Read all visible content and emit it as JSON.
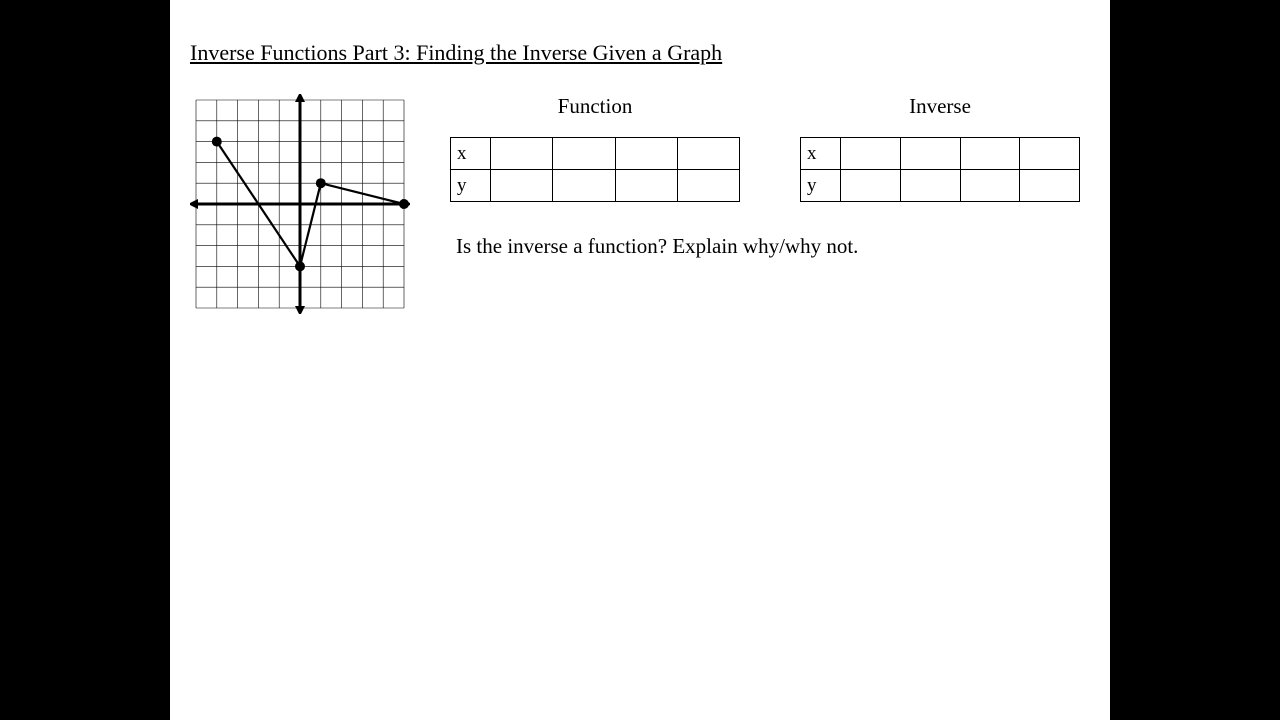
{
  "title": "Inverse Functions Part 3: Finding the Inverse Given a Graph",
  "tables": {
    "function": {
      "title": "Function",
      "row_x_label": "x",
      "row_y_label": "y"
    },
    "inverse": {
      "title": "Inverse",
      "row_x_label": "x",
      "row_y_label": "y"
    }
  },
  "question": "Is the inverse a function? Explain why/why not.",
  "chart_data": {
    "type": "line",
    "title": "",
    "x_range": [
      -5,
      5
    ],
    "y_range": [
      -5,
      5
    ],
    "grid": true,
    "points": [
      {
        "x": -4,
        "y": 3
      },
      {
        "x": 0,
        "y": -3
      },
      {
        "x": 1,
        "y": 1
      },
      {
        "x": 5,
        "y": 0
      }
    ],
    "segments": [
      {
        "from": [
          -4,
          3
        ],
        "to": [
          0,
          -3
        ]
      },
      {
        "from": [
          0,
          -3
        ],
        "to": [
          1,
          1
        ]
      },
      {
        "from": [
          1,
          1
        ],
        "to": [
          5,
          0
        ]
      }
    ]
  }
}
